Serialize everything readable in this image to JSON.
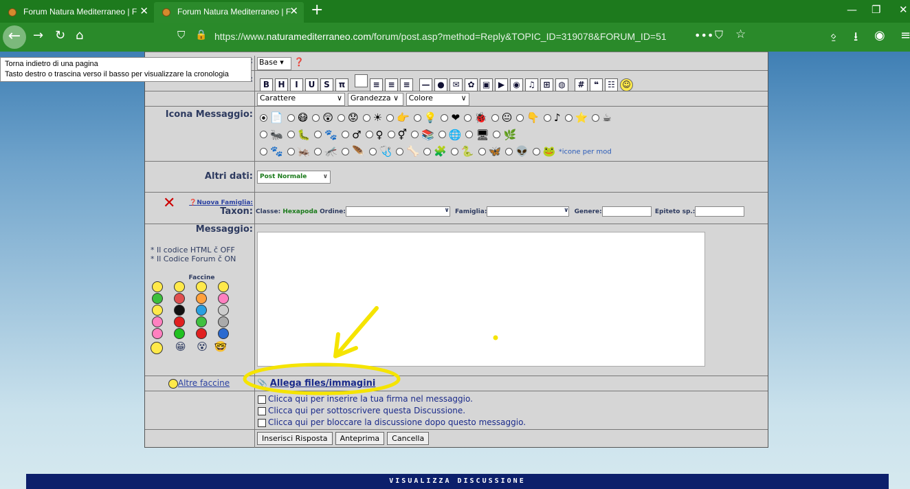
{
  "tabs": [
    {
      "title": "Forum Natura Mediterraneo | F"
    },
    {
      "title": "Forum Natura Mediterraneo | F"
    }
  ],
  "url": {
    "prefix": "https://www.",
    "domain": "naturamediterraneo.com",
    "path": "/forum/post.asp?method=Reply&TOPIC_ID=319078&FORUM_ID=51"
  },
  "tooltip": {
    "line1": "Torna indietro di una pagina",
    "line2": "Tasto destro o trascina verso il basso per visualizzare la cronologia"
  },
  "form": {
    "mode_select": "Base",
    "font_select": "Carattere",
    "size_select": "Grandezza",
    "color_select": "Colore",
    "icon_label": "Icona Messaggio:",
    "icon_mod_note": "*icone per mod",
    "other_label": "Altri dati:",
    "other_select": "Post Normale",
    "new_family": "Nuova Famiglia:",
    "taxon_label": "Taxon:",
    "classe_label": "Classe:",
    "classe_value": "Hexapoda",
    "ordine_label": "Ordine:",
    "famiglia_label": "Famiglia:",
    "genere_label": "Genere:",
    "epiteto_label": "Epiteto sp.:",
    "message_label": "Messaggio:",
    "html_note": "* Il codice HTML č OFF",
    "forum_note": "* Il Codice Forum č ON",
    "faccine_title": "Faccine",
    "altre_faccine": "Altre faccine",
    "attach": "Allega files/immagini",
    "opt1": "Clicca qui per inserire la tua firma nel messaggio.",
    "opt2": "Clicca qui per sottoscrivere questa Discussione.",
    "opt3": "Clicca qui per bloccare la discussione dopo questo messaggio.",
    "btn_reply": "Inserisci Risposta",
    "btn_preview": "Anteprima",
    "btn_cancel": "Cancella"
  },
  "toolbar_icons": [
    "bold-icon",
    "heading-icon",
    "italic-icon",
    "underline-icon",
    "strike-icon",
    "pi-icon",
    "pre-icon",
    "align-left-icon",
    "align-center-icon",
    "align-right-icon",
    "hr-icon",
    "globe-icon",
    "email-icon",
    "image-icon",
    "picture-icon",
    "youtube-icon",
    "flash-icon",
    "media-icon",
    "table-icon",
    "web-icon",
    "hash-icon",
    "quote-icon",
    "list-icon",
    "smiley-icon"
  ],
  "toolbar_labels": [
    "B",
    "H",
    "I",
    "U",
    "S",
    "π",
    "",
    "≡",
    "≡",
    "≡",
    "—",
    "●",
    "✉",
    "✿",
    "▣",
    "▶",
    "◉",
    "♫",
    "⊞",
    "◍",
    "#",
    "❝",
    "☷",
    "☺"
  ],
  "footer": "VISUALIZZA DISCUSSIONE",
  "colors": {
    "tabbar": "#1d7a1d",
    "navbar": "#2a8a2a",
    "label_text": "#2d3a5f",
    "annotation": "#f5e400",
    "footer": "#0c1f6b"
  }
}
